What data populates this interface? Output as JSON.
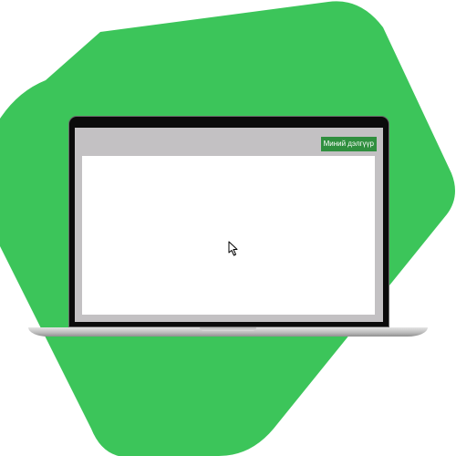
{
  "colors": {
    "accent_green": "#3cc55a",
    "button_green": "#2f8f3e",
    "toolbar_gray": "#c3c1c3"
  },
  "toolbar": {
    "my_store_label": "Миний дэлгүүр"
  },
  "icons": {
    "cursor": "mouse-pointer-icon"
  }
}
